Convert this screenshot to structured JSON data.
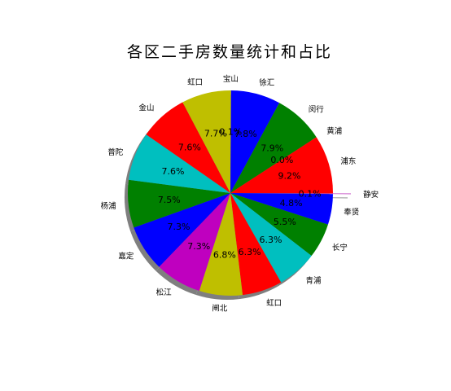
{
  "chart_data": {
    "type": "pie",
    "title": "各区二手房数量统计和占比",
    "start_angle_deg": 90,
    "direction": "clockwise",
    "shadow": true,
    "slices": [
      {
        "label": "宝山",
        "value": 0.1,
        "value_label": "0.1%",
        "color": "#c8c800",
        "explode": false
      },
      {
        "label": "徐汇",
        "value": 7.8,
        "value_label": "7.8%",
        "color": "#0000ff",
        "explode": false
      },
      {
        "label": "闵行",
        "value": 7.9,
        "value_label": "7.9%",
        "color": "#008000",
        "explode": false
      },
      {
        "label": "黄浦",
        "value": 0.0,
        "value_label": "0.0%",
        "color": "#ff0000",
        "explode": false
      },
      {
        "label": "浦东",
        "value": 9.2,
        "value_label": "9.2%",
        "color": "#ff0000",
        "explode": false
      },
      {
        "label": "静安",
        "value": 0.1,
        "value_label": "0.1%",
        "color": "#bf40bf",
        "explode": true
      },
      {
        "label": "奉贤",
        "value": 4.8,
        "value_label": "4.8%",
        "color": "#0000ff",
        "explode": false
      },
      {
        "label": "长宁",
        "value": 5.5,
        "value_label": "5.5%",
        "color": "#008000",
        "explode": false
      },
      {
        "label": "青浦",
        "value": 6.3,
        "value_label": "6.3%",
        "color": "#00bfbf",
        "explode": false
      },
      {
        "label": "虹口",
        "value": 6.3,
        "value_label": "6.3%",
        "color": "#ff0000",
        "explode": false
      },
      {
        "label": "闸北",
        "value": 6.8,
        "value_label": "6.8%",
        "color": "#bfbf00",
        "explode": false
      },
      {
        "label": "松江",
        "value": 7.3,
        "value_label": "7.3%",
        "color": "#bf00bf",
        "explode": false
      },
      {
        "label": "嘉定",
        "value": 7.3,
        "value_label": "7.3%",
        "color": "#0000ff",
        "explode": false
      },
      {
        "label": "杨浦",
        "value": 7.5,
        "value_label": "7.5%",
        "color": "#008000",
        "explode": false
      },
      {
        "label": "普陀",
        "value": 7.6,
        "value_label": "7.6%",
        "color": "#00bfbf",
        "explode": false
      },
      {
        "label": "金山",
        "value": 7.6,
        "value_label": "7.6%",
        "color": "#ff0000",
        "explode": false
      },
      {
        "label": "虹口",
        "value": 7.7,
        "value_label": "7.7%",
        "color": "#bfbf00",
        "explode": false
      }
    ]
  }
}
